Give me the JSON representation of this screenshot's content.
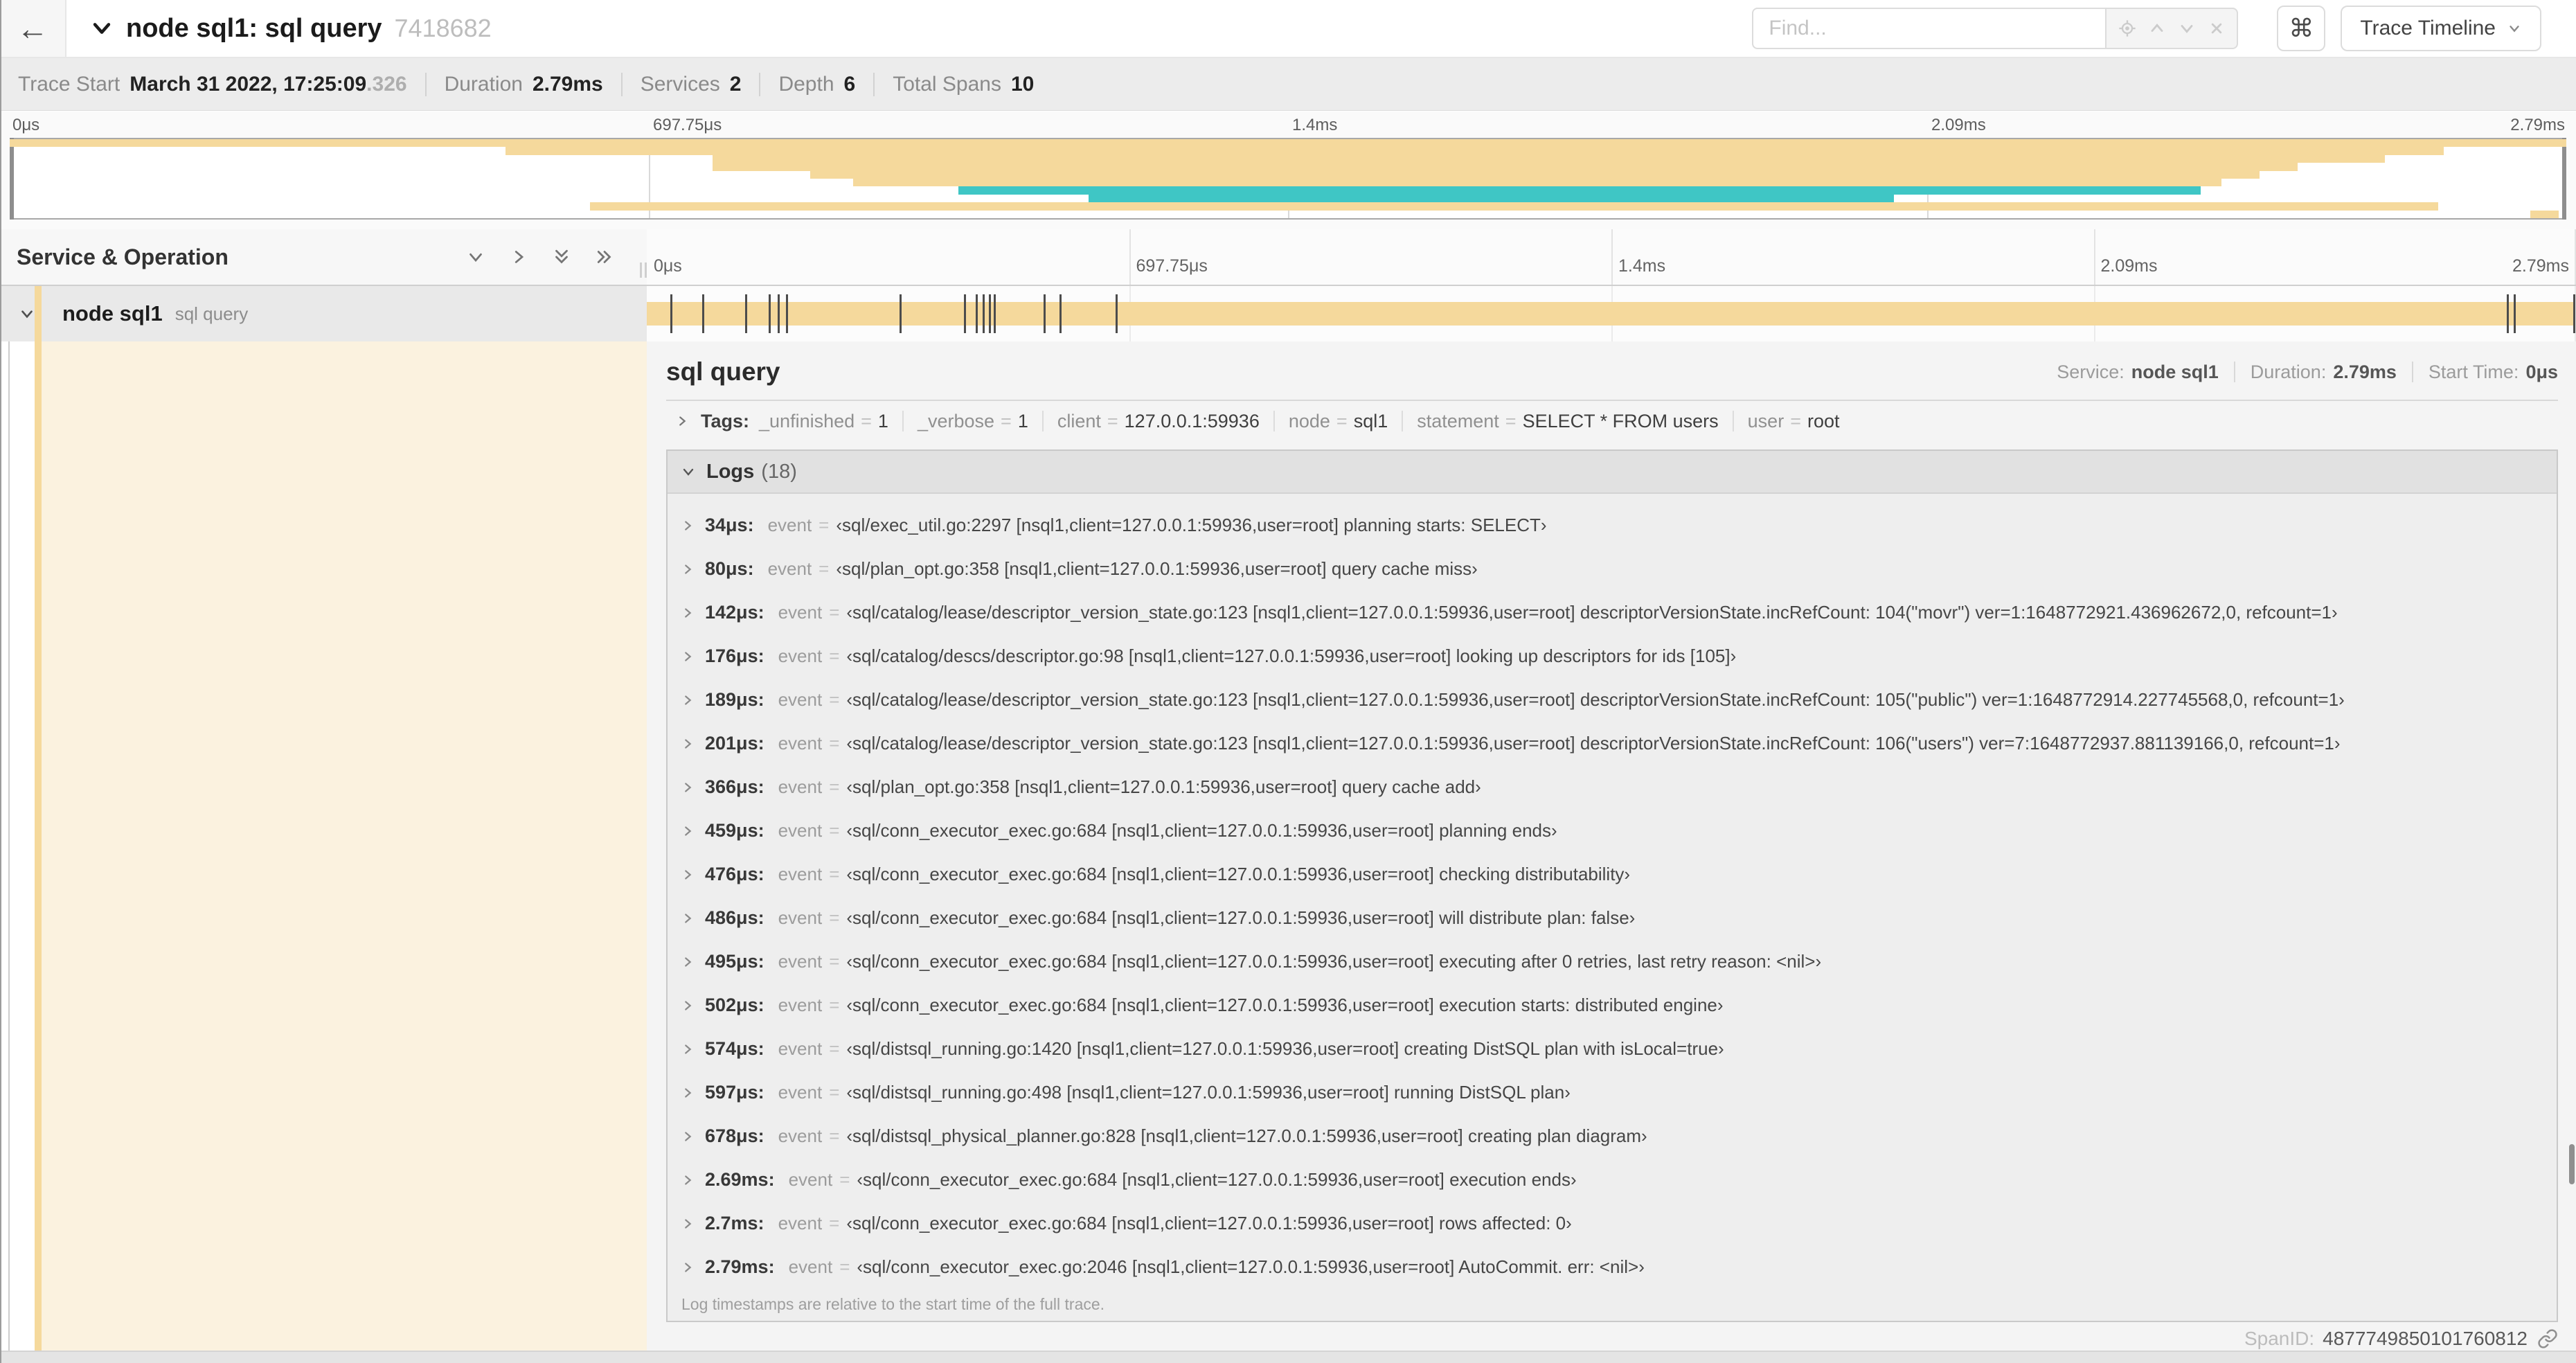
{
  "header": {
    "back_icon": "←",
    "title": "node sql1: sql query",
    "trace_id": "7418682",
    "find_placeholder": "Find...",
    "shortcut_icon": "⌘",
    "view_selector": "Trace Timeline"
  },
  "summary": {
    "items": [
      {
        "label": "Trace Start",
        "value": "March 31 2022, 17:25:09",
        "suffix": ".326"
      },
      {
        "label": "Duration",
        "value": "2.79ms"
      },
      {
        "label": "Services",
        "value": "2"
      },
      {
        "label": "Depth",
        "value": "6"
      },
      {
        "label": "Total Spans",
        "value": "10"
      }
    ]
  },
  "colors": {
    "span_beige": "#f5d99c",
    "span_teal": "#3fc6c5",
    "detail_cream": "#fbf2df"
  },
  "timeline": {
    "header_label": "Service & Operation",
    "duration_us": 2790,
    "ticks": [
      {
        "label": "0μs",
        "pct": 0
      },
      {
        "label": "697.75μs",
        "pct": 25
      },
      {
        "label": "1.4ms",
        "pct": 50
      },
      {
        "label": "2.09ms",
        "pct": 75
      },
      {
        "label": "2.79ms",
        "pct": 100
      }
    ],
    "minimap_spans": [
      {
        "row": 0,
        "start": 0,
        "end": 100,
        "color": "beige"
      },
      {
        "row": 1,
        "start": 19.4,
        "end": 95.2,
        "color": "beige"
      },
      {
        "row": 2,
        "start": 27.5,
        "end": 92.9,
        "color": "beige"
      },
      {
        "row": 3,
        "start": 27.5,
        "end": 89.5,
        "color": "beige"
      },
      {
        "row": 4,
        "start": 31.3,
        "end": 88,
        "color": "beige"
      },
      {
        "row": 5,
        "start": 33,
        "end": 86.5,
        "color": "beige"
      },
      {
        "row": 6,
        "start": 37.1,
        "end": 85.7,
        "color": "teal"
      },
      {
        "row": 7,
        "start": 42.2,
        "end": 73.7,
        "color": "teal"
      },
      {
        "row": 8,
        "start": 22.7,
        "end": 95,
        "color": "beige"
      },
      {
        "row": 9,
        "start": 98.6,
        "end": 99.7,
        "color": "beige"
      }
    ],
    "log_marker_times_us": [
      34,
      80,
      142,
      176,
      189,
      201,
      366,
      459,
      476,
      486,
      495,
      502,
      574,
      597,
      678,
      2690,
      2700,
      2790
    ]
  },
  "span_row": {
    "service": "node sql1",
    "operation": "sql query"
  },
  "detail": {
    "title": "sql query",
    "meta": [
      {
        "label": "Service:",
        "value": "node sql1"
      },
      {
        "label": "Duration:",
        "value": "2.79ms"
      },
      {
        "label": "Start Time:",
        "value": "0μs"
      }
    ],
    "tags_label": "Tags:",
    "tags": [
      {
        "key": "_unfinished",
        "value": "1"
      },
      {
        "key": "_verbose",
        "value": "1"
      },
      {
        "key": "client",
        "value": "127.0.0.1:59936"
      },
      {
        "key": "node",
        "value": "sql1"
      },
      {
        "key": "statement",
        "value": "SELECT * FROM users"
      },
      {
        "key": "user",
        "value": "root"
      }
    ],
    "logs_label": "Logs",
    "logs_count": "(18)",
    "logs": [
      {
        "time": "34μs:",
        "key": "event",
        "value": "‹sql/exec_util.go:2297 [nsql1,client=127.0.0.1:59936,user=root] planning starts: SELECT›"
      },
      {
        "time": "80μs:",
        "key": "event",
        "value": "‹sql/plan_opt.go:358 [nsql1,client=127.0.0.1:59936,user=root] query cache miss›"
      },
      {
        "time": "142μs:",
        "key": "event",
        "value": "‹sql/catalog/lease/descriptor_version_state.go:123 [nsql1,client=127.0.0.1:59936,user=root] descriptorVersionState.incRefCount: 104(\"movr\") ver=1:1648772921.436962672,0, refcount=1›"
      },
      {
        "time": "176μs:",
        "key": "event",
        "value": "‹sql/catalog/descs/descriptor.go:98 [nsql1,client=127.0.0.1:59936,user=root] looking up descriptors for ids [105]›"
      },
      {
        "time": "189μs:",
        "key": "event",
        "value": "‹sql/catalog/lease/descriptor_version_state.go:123 [nsql1,client=127.0.0.1:59936,user=root] descriptorVersionState.incRefCount: 105(\"public\") ver=1:1648772914.227745568,0, refcount=1›"
      },
      {
        "time": "201μs:",
        "key": "event",
        "value": "‹sql/catalog/lease/descriptor_version_state.go:123 [nsql1,client=127.0.0.1:59936,user=root] descriptorVersionState.incRefCount: 106(\"users\") ver=7:1648772937.881139166,0, refcount=1›"
      },
      {
        "time": "366μs:",
        "key": "event",
        "value": "‹sql/plan_opt.go:358 [nsql1,client=127.0.0.1:59936,user=root] query cache add›"
      },
      {
        "time": "459μs:",
        "key": "event",
        "value": "‹sql/conn_executor_exec.go:684 [nsql1,client=127.0.0.1:59936,user=root] planning ends›"
      },
      {
        "time": "476μs:",
        "key": "event",
        "value": "‹sql/conn_executor_exec.go:684 [nsql1,client=127.0.0.1:59936,user=root] checking distributability›"
      },
      {
        "time": "486μs:",
        "key": "event",
        "value": "‹sql/conn_executor_exec.go:684 [nsql1,client=127.0.0.1:59936,user=root] will distribute plan: false›"
      },
      {
        "time": "495μs:",
        "key": "event",
        "value": "‹sql/conn_executor_exec.go:684 [nsql1,client=127.0.0.1:59936,user=root] executing after 0 retries, last retry reason: <nil>›"
      },
      {
        "time": "502μs:",
        "key": "event",
        "value": "‹sql/conn_executor_exec.go:684 [nsql1,client=127.0.0.1:59936,user=root] execution starts: distributed engine›"
      },
      {
        "time": "574μs:",
        "key": "event",
        "value": "‹sql/distsql_running.go:1420 [nsql1,client=127.0.0.1:59936,user=root] creating DistSQL plan with isLocal=true›"
      },
      {
        "time": "597μs:",
        "key": "event",
        "value": "‹sql/distsql_running.go:498 [nsql1,client=127.0.0.1:59936,user=root] running DistSQL plan›"
      },
      {
        "time": "678μs:",
        "key": "event",
        "value": "‹sql/distsql_physical_planner.go:828 [nsql1,client=127.0.0.1:59936,user=root] creating plan diagram›"
      },
      {
        "time": "2.69ms:",
        "key": "event",
        "value": "‹sql/conn_executor_exec.go:684 [nsql1,client=127.0.0.1:59936,user=root] execution ends›"
      },
      {
        "time": "2.7ms:",
        "key": "event",
        "value": "‹sql/conn_executor_exec.go:684 [nsql1,client=127.0.0.1:59936,user=root] rows affected: 0›"
      },
      {
        "time": "2.79ms:",
        "key": "event",
        "value": "‹sql/conn_executor_exec.go:2046 [nsql1,client=127.0.0.1:59936,user=root] AutoCommit. err: <nil>›"
      }
    ],
    "logs_footnote": "Log timestamps are relative to the start time of the full trace.",
    "span_id_label": "SpanID:",
    "span_id": "4877749850101760812"
  }
}
